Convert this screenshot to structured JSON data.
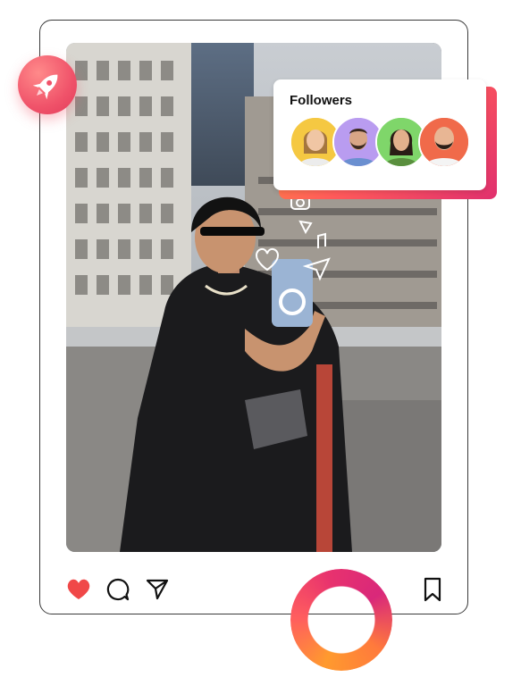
{
  "followers": {
    "title": "Followers",
    "avatars": [
      {
        "name": "avatar-woman-blonde",
        "bg": "#f5c842"
      },
      {
        "name": "avatar-man-beard",
        "bg": "#b99cf0"
      },
      {
        "name": "avatar-woman-dark",
        "bg": "#7fd66a"
      },
      {
        "name": "avatar-man-bald",
        "bg": "#f06a4a"
      }
    ]
  },
  "icons": {
    "rocket": "rocket-icon",
    "like": "heart-icon",
    "comment": "comment-icon",
    "share": "send-icon",
    "save": "bookmark-icon"
  },
  "colors": {
    "accent_orange": "#ff9a2e",
    "accent_pink": "#e8326e",
    "like_red": "#f04848"
  }
}
